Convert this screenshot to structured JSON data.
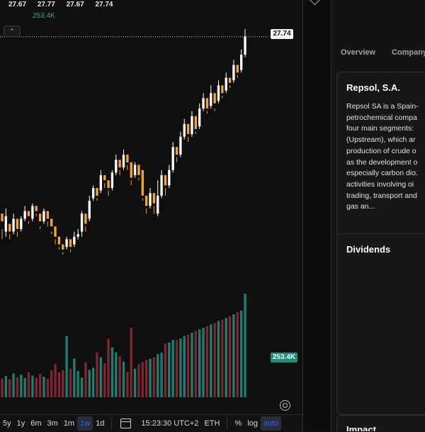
{
  "ohlc": {
    "open": "27.67",
    "high": "27.77",
    "low": "27.67",
    "close": "27.74"
  },
  "volume_label": "253.4K",
  "price_axis": {
    "last_price_tag": "27.74",
    "volume_tag": "253.4K"
  },
  "toolbar": {
    "ranges": [
      "5y",
      "1y",
      "6m",
      "3m",
      "1m",
      "1w",
      "1d"
    ],
    "active_range": "1w",
    "clock": "15:23:30 UTC+2",
    "session": "ETH",
    "percent": "%",
    "log": "log",
    "auto": "auto"
  },
  "right_panel": {
    "tabs": [
      "Overview",
      "Company"
    ],
    "company_name": "Repsol, S.A.",
    "description_lines": [
      "Repsol SA is a Spain-",
      "petrochemical compa",
      "four main segments:",
      "(Upstream), which ar",
      "production of crude o",
      "as the development o",
      "especially carbon dio.",
      "activities involving oi",
      "trading, transport and",
      "gas an..."
    ],
    "dividends_title": "Dividends",
    "impact_title": "Impact"
  },
  "colors": {
    "up": "#ffffff",
    "down": "#f5a623",
    "volume_up": "#1e7f6e",
    "volume_down": "#7f2633",
    "accent": "#2962ff"
  },
  "chart_data": {
    "type": "candlestick",
    "interval_range": "1w",
    "last_price": 27.74,
    "ylim": [
      26.5,
      27.8
    ],
    "candles": [
      [
        27.05,
        27.02,
        26.99,
        26.95
      ],
      [
        26.98,
        27.04,
        27.07,
        26.96
      ],
      [
        27.01,
        26.98,
        26.97,
        26.95
      ],
      [
        26.98,
        27.03,
        27.05,
        26.97
      ],
      [
        27.03,
        26.99,
        26.98,
        26.96
      ],
      [
        26.99,
        27.03,
        27.04,
        26.98
      ],
      [
        27.03,
        27.06,
        27.08,
        27.02
      ],
      [
        27.06,
        27.04,
        27.02,
        27.01
      ],
      [
        27.03,
        27.08,
        27.09,
        27.02
      ],
      [
        27.08,
        27.06,
        27.05,
        27.04
      ],
      [
        27.05,
        27.02,
        27.0,
        26.99
      ],
      [
        27.02,
        27.06,
        27.07,
        27.01
      ],
      [
        27.06,
        27.03,
        27.02,
        27.0
      ],
      [
        27.03,
        27.0,
        26.98,
        26.97
      ],
      [
        27.0,
        26.96,
        26.95,
        26.93
      ],
      [
        26.96,
        26.93,
        26.92,
        26.91
      ],
      [
        26.93,
        26.91,
        26.9,
        26.89
      ],
      [
        26.92,
        26.95,
        26.96,
        26.91
      ],
      [
        26.95,
        26.92,
        26.91,
        26.9
      ],
      [
        26.93,
        26.96,
        26.98,
        26.92
      ],
      [
        26.96,
        26.97,
        26.99,
        26.95
      ],
      [
        26.98,
        27.05,
        27.06,
        26.96
      ],
      [
        27.05,
        27.01,
        27.0,
        26.98
      ],
      [
        27.03,
        27.1,
        27.12,
        27.02
      ],
      [
        27.11,
        27.15,
        27.16,
        27.1
      ],
      [
        27.15,
        27.12,
        27.11,
        27.1
      ],
      [
        27.14,
        27.2,
        27.22,
        27.13
      ],
      [
        27.2,
        27.18,
        27.17,
        27.15
      ],
      [
        27.18,
        27.15,
        27.14,
        27.12
      ],
      [
        27.15,
        27.21,
        27.22,
        27.14
      ],
      [
        27.21,
        27.26,
        27.28,
        27.2
      ],
      [
        27.26,
        27.23,
        27.22,
        27.2
      ],
      [
        27.23,
        27.28,
        27.3,
        27.22
      ],
      [
        27.28,
        27.25,
        27.24,
        27.22
      ],
      [
        27.25,
        27.19,
        27.18,
        27.16
      ],
      [
        27.2,
        27.24,
        27.25,
        27.19
      ],
      [
        27.24,
        27.2,
        27.19,
        27.18
      ],
      [
        27.22,
        27.12,
        27.11,
        27.1
      ],
      [
        27.12,
        27.08,
        27.07,
        27.05
      ],
      [
        27.08,
        27.13,
        27.15,
        27.07
      ],
      [
        27.13,
        27.09,
        27.08,
        27.05
      ],
      [
        27.05,
        27.12,
        27.18,
        27.04
      ],
      [
        27.12,
        27.2,
        27.22,
        27.11
      ],
      [
        27.2,
        27.16,
        27.15,
        27.12
      ],
      [
        27.16,
        27.22,
        27.24,
        27.15
      ],
      [
        27.22,
        27.31,
        27.33,
        27.21
      ],
      [
        27.31,
        27.28,
        27.27,
        27.25
      ],
      [
        27.28,
        27.35,
        27.37,
        27.27
      ],
      [
        27.35,
        27.4,
        27.42,
        27.34
      ],
      [
        27.4,
        27.36,
        27.35,
        27.33
      ],
      [
        27.36,
        27.43,
        27.45,
        27.35
      ],
      [
        27.43,
        27.38,
        27.37,
        27.36
      ],
      [
        27.39,
        27.46,
        27.48,
        27.38
      ],
      [
        27.46,
        27.5,
        27.52,
        27.45
      ],
      [
        27.5,
        27.46,
        27.45,
        27.44
      ],
      [
        27.47,
        27.52,
        27.55,
        27.46
      ],
      [
        27.52,
        27.48,
        27.46,
        27.45
      ],
      [
        27.49,
        27.55,
        27.57,
        27.48
      ],
      [
        27.55,
        27.52,
        27.51,
        27.5
      ],
      [
        27.53,
        27.58,
        27.6,
        27.52
      ],
      [
        27.58,
        27.56,
        27.55,
        27.54
      ],
      [
        27.57,
        27.63,
        27.65,
        27.56
      ],
      [
        27.63,
        27.6,
        27.59,
        27.58
      ],
      [
        27.61,
        27.67,
        27.69,
        27.6
      ],
      [
        27.67,
        27.74,
        27.77,
        27.66
      ]
    ],
    "volumes": [
      46,
      52,
      44,
      58,
      49,
      55,
      47,
      61,
      53,
      48,
      57,
      50,
      45,
      66,
      81,
      61,
      66,
      150,
      70,
      95,
      64,
      48,
      85,
      67,
      72,
      110,
      98,
      83,
      143,
      122,
      110,
      100,
      87,
      62,
      170,
      70,
      81,
      86,
      91,
      94,
      98,
      106,
      109,
      131,
      134,
      140,
      140,
      144,
      150,
      153,
      158,
      162,
      166,
      170,
      174,
      178,
      182,
      187,
      190,
      194,
      199,
      203,
      208,
      212,
      253.4
    ]
  }
}
